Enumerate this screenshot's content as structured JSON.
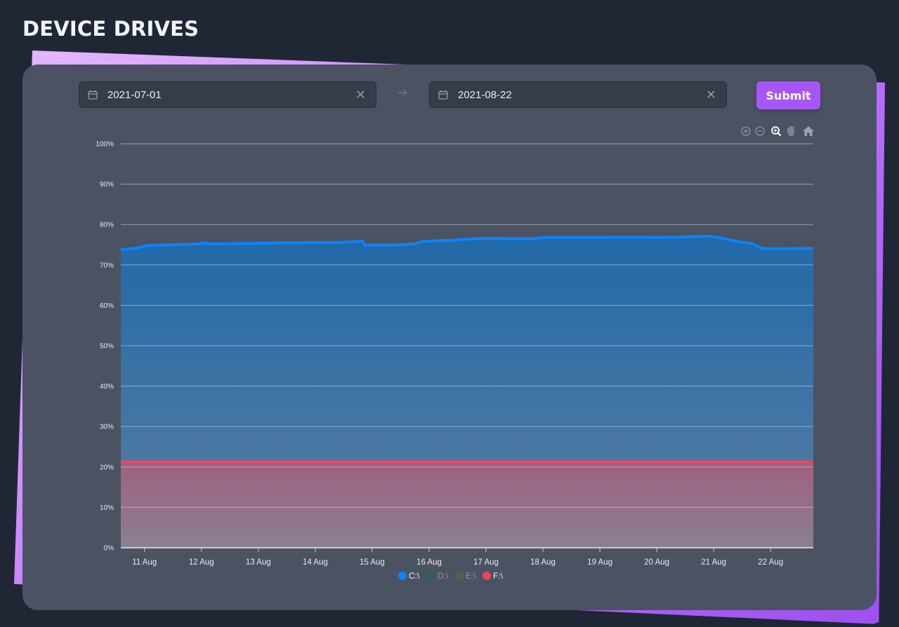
{
  "page": {
    "title": "DEVICE DRIVES"
  },
  "filters": {
    "start_date": "2021-07-01",
    "end_date": "2021-08-22",
    "submit_label": "Submit"
  },
  "toolbar": {
    "icons": [
      "zoom-in-icon",
      "zoom-out-icon",
      "selection-zoom-icon",
      "pan-icon",
      "reset-zoom-icon"
    ]
  },
  "colors": {
    "c_drive": "#0a84ff",
    "d_drive": "#2c5f5a",
    "e_drive": "#5e574b",
    "f_drive": "#f0435c",
    "accent": "#a855f7"
  },
  "chart_data": {
    "type": "area",
    "y_ticks": [
      "0%",
      "10%",
      "20%",
      "30%",
      "40%",
      "50%",
      "60%",
      "70%",
      "80%",
      "90%",
      "100%"
    ],
    "ylim": [
      0,
      100
    ],
    "x_range": [
      "2021-08-10T14:00",
      "2021-08-22T18:00"
    ],
    "x_ticks": [
      {
        "date": "2021-08-11",
        "label": "11 Aug"
      },
      {
        "date": "2021-08-12",
        "label": "12 Aug"
      },
      {
        "date": "2021-08-13",
        "label": "13 Aug"
      },
      {
        "date": "2021-08-14",
        "label": "14 Aug"
      },
      {
        "date": "2021-08-15",
        "label": "15 Aug"
      },
      {
        "date": "2021-08-16",
        "label": "16 Aug"
      },
      {
        "date": "2021-08-17",
        "label": "17 Aug"
      },
      {
        "date": "2021-08-18",
        "label": "18 Aug"
      },
      {
        "date": "2021-08-19",
        "label": "19 Aug"
      },
      {
        "date": "2021-08-20",
        "label": "20 Aug"
      },
      {
        "date": "2021-08-21",
        "label": "21 Aug"
      },
      {
        "date": "2021-08-22",
        "label": "22 Aug"
      }
    ],
    "grid": true,
    "legend_position": "bottom-center",
    "series": [
      {
        "name": "C:\\",
        "color_key": "c_drive",
        "visible": true,
        "points": [
          [
            "2021-08-10T14:00",
            73.8
          ],
          [
            "2021-08-10T20:00",
            74.1
          ],
          [
            "2021-08-11T01:00",
            74.8
          ],
          [
            "2021-08-11T12:00",
            75.0
          ],
          [
            "2021-08-11T23:00",
            75.2
          ],
          [
            "2021-08-12T02:00",
            75.5
          ],
          [
            "2021-08-12T03:00",
            75.2
          ],
          [
            "2021-08-12T18:00",
            75.3
          ],
          [
            "2021-08-13T12:00",
            75.5
          ],
          [
            "2021-08-14T12:00",
            75.6
          ],
          [
            "2021-08-14T20:00",
            75.9
          ],
          [
            "2021-08-14T21:00",
            74.9
          ],
          [
            "2021-08-15T12:00",
            75.0
          ],
          [
            "2021-08-15T18:00",
            75.2
          ],
          [
            "2021-08-15T21:00",
            75.8
          ],
          [
            "2021-08-16T12:00",
            76.2
          ],
          [
            "2021-08-16T23:00",
            76.6
          ],
          [
            "2021-08-17T12:00",
            76.5
          ],
          [
            "2021-08-17T20:00",
            76.5
          ],
          [
            "2021-08-18T00:00",
            76.8
          ],
          [
            "2021-08-19T00:00",
            76.8
          ],
          [
            "2021-08-19T12:00",
            76.9
          ],
          [
            "2021-08-20T00:00",
            76.8
          ],
          [
            "2021-08-20T22:00",
            77.1
          ],
          [
            "2021-08-21T02:00",
            76.8
          ],
          [
            "2021-08-21T10:00",
            75.8
          ],
          [
            "2021-08-21T16:00",
            75.3
          ],
          [
            "2021-08-21T20:00",
            74.2
          ],
          [
            "2021-08-22T00:00",
            74.0
          ],
          [
            "2021-08-22T18:00",
            74.1
          ]
        ]
      },
      {
        "name": "D:\\",
        "color_key": "d_drive",
        "visible": false,
        "points": []
      },
      {
        "name": "E:\\",
        "color_key": "e_drive",
        "visible": false,
        "points": []
      },
      {
        "name": "F:\\",
        "color_key": "f_drive",
        "visible": true,
        "points": [
          [
            "2021-08-10T14:00",
            21.2
          ],
          [
            "2021-08-22T18:00",
            21.2
          ]
        ]
      }
    ]
  }
}
